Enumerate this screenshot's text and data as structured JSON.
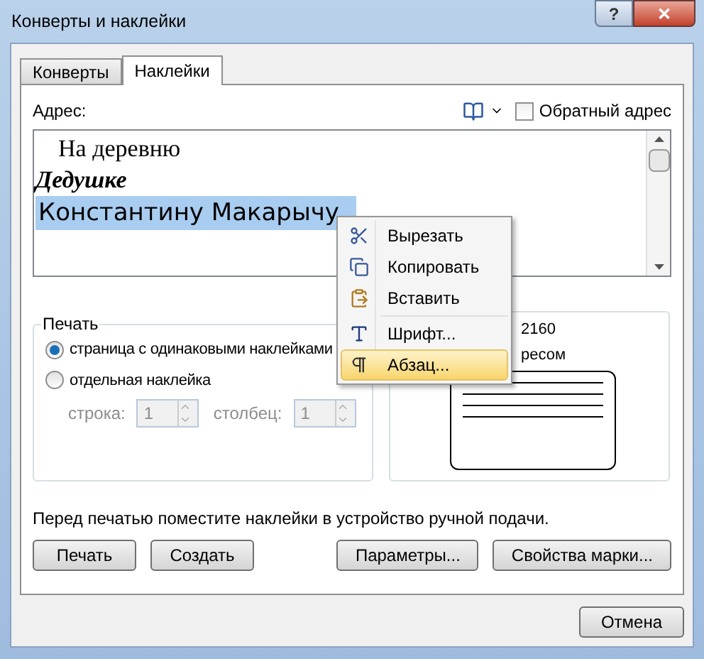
{
  "window": {
    "title": "Конверты и наклейки",
    "help_button": "?",
    "close_button": "✕"
  },
  "tabs": [
    {
      "label": "Конверты",
      "selected": false
    },
    {
      "label": "Наклейки",
      "selected": true
    }
  ],
  "address": {
    "label": "Адрес:",
    "return_address": {
      "label": "Обратный адрес",
      "checked": false
    },
    "lines": [
      {
        "text": "На деревню",
        "kind": "plain",
        "selected": false
      },
      {
        "text": "Дедушке",
        "kind": "bold_italic",
        "selected": false
      },
      {
        "text": "Константину Макарычу",
        "kind": "large",
        "selected": true
      }
    ]
  },
  "context_menu": [
    {
      "kind": "item",
      "label": "Вырезать",
      "selected": false
    },
    {
      "kind": "item",
      "label": "Копировать",
      "selected": false
    },
    {
      "kind": "item",
      "label": "Вставить",
      "selected": false
    },
    {
      "kind": "separator"
    },
    {
      "kind": "item",
      "label": "Шрифт...",
      "selected": false
    },
    {
      "kind": "item",
      "label": "Абзац...",
      "selected": true
    }
  ],
  "print": {
    "title": "Печать",
    "options": [
      {
        "label": "страница с одинаковыми наклейками",
        "selected": true
      },
      {
        "label": "отдельная наклейка",
        "selected": false
      }
    ],
    "row": {
      "label": "строка:",
      "value": "1",
      "disabled": true
    },
    "column": {
      "label": "столбец:",
      "value": "1",
      "disabled": true
    }
  },
  "label_panel": {
    "lines": [
      "2160",
      "ресом"
    ]
  },
  "note": "Перед печатью поместите наклейки в устройство ручной подачи.",
  "buttons": [
    "Печать",
    "Создать",
    "Параметры...",
    "Свойства марки..."
  ],
  "cancel": "Отмена"
}
